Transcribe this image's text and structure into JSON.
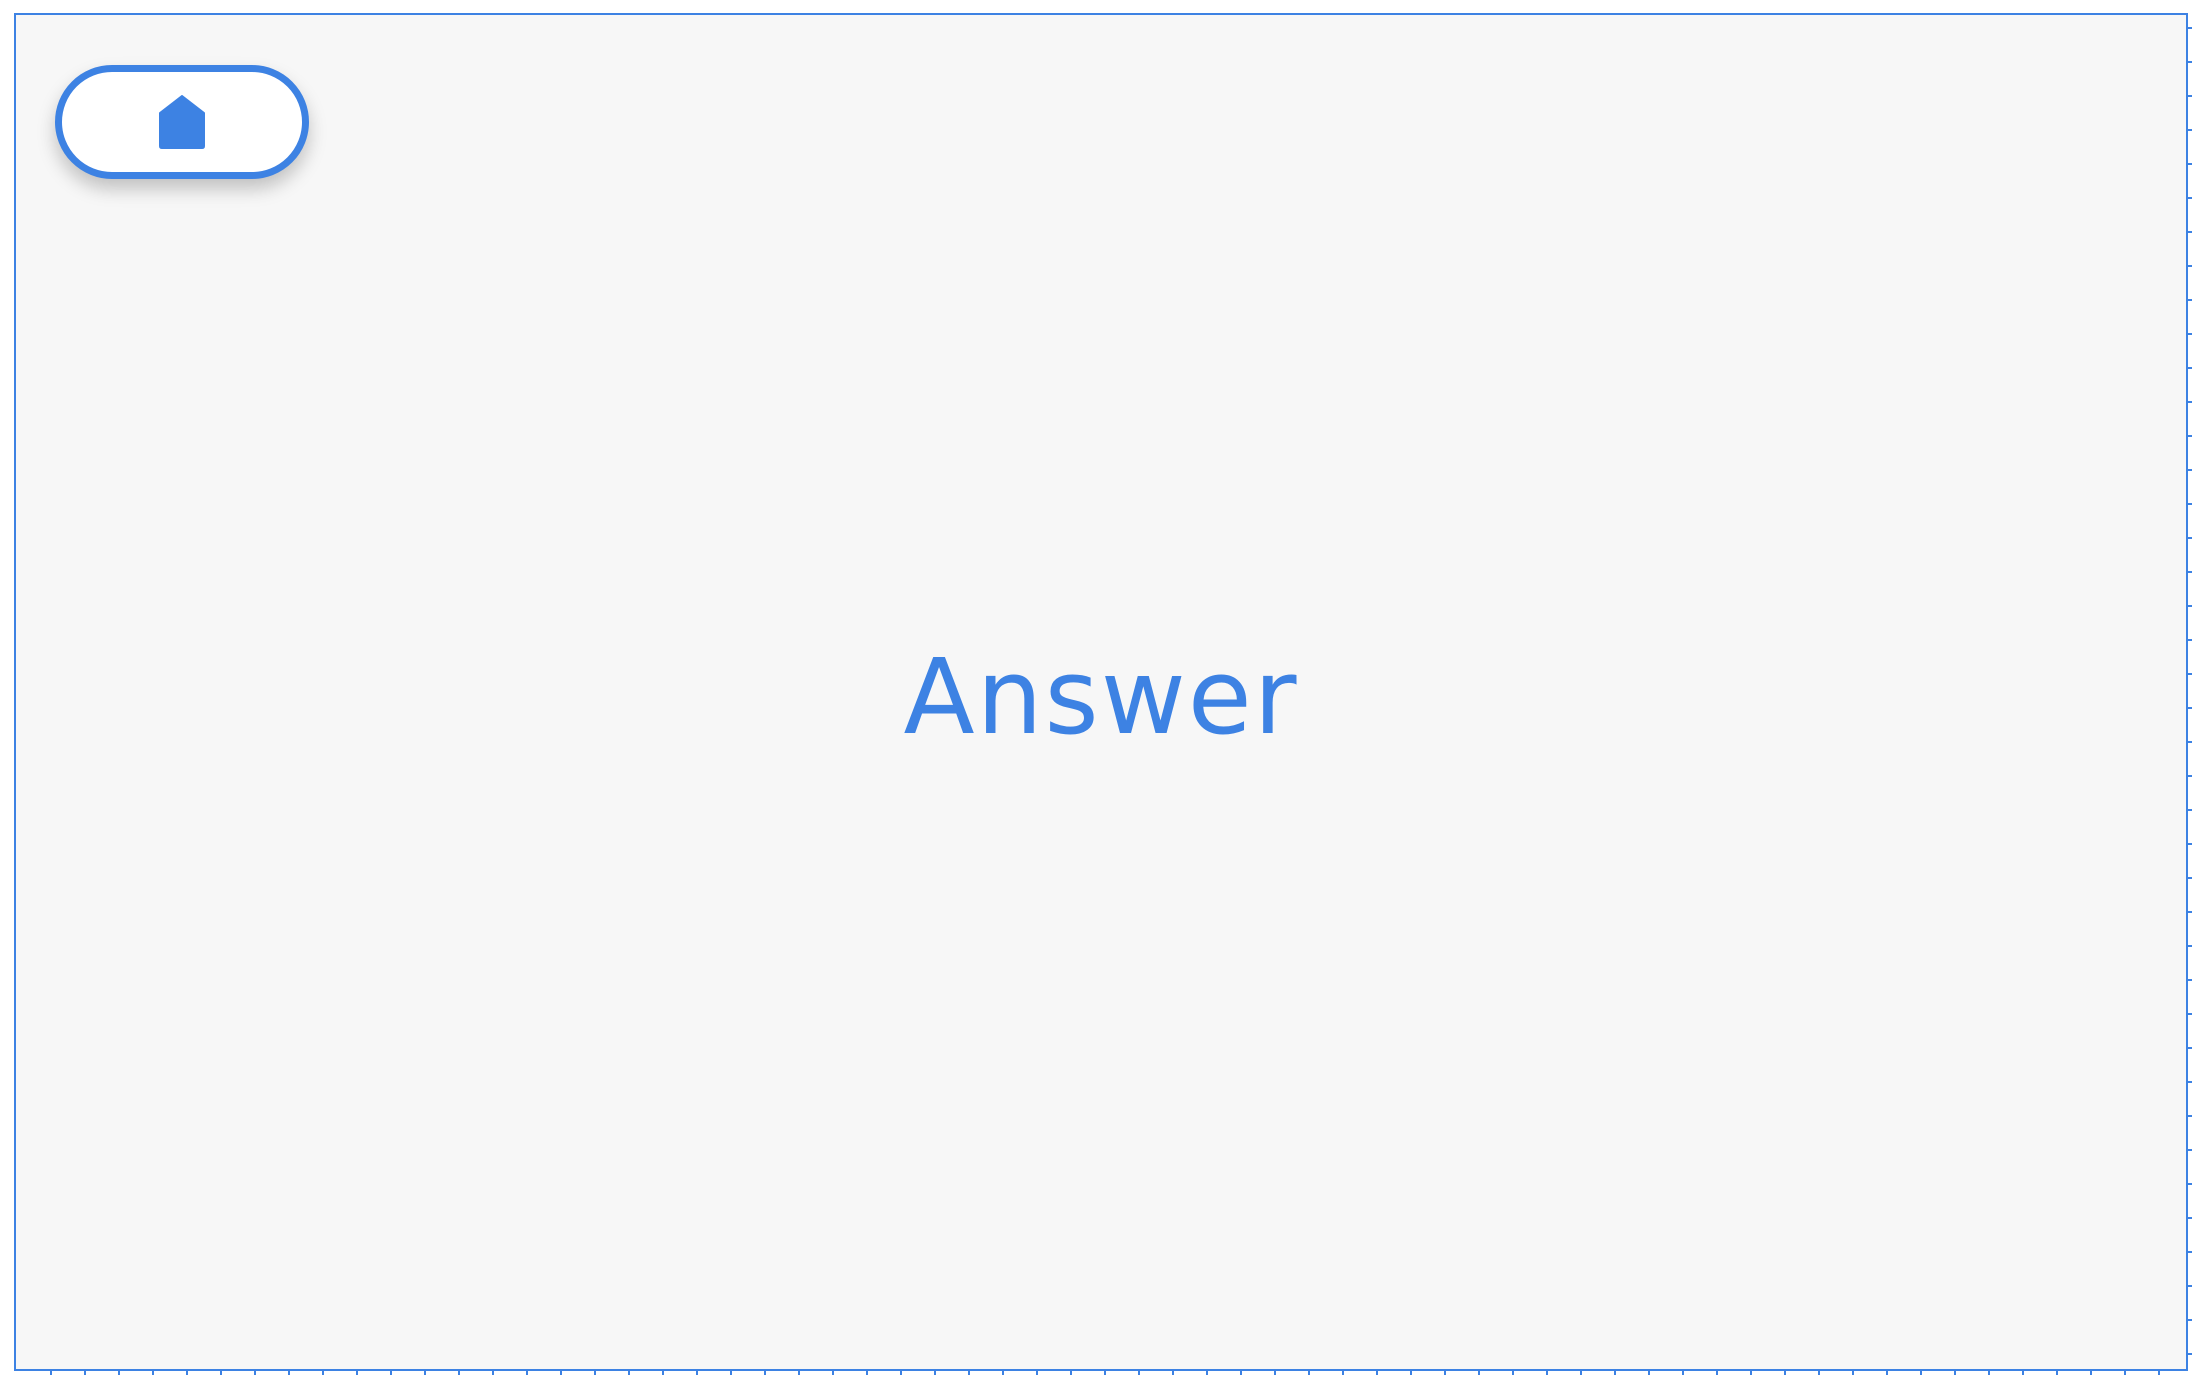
{
  "home_button": {
    "icon": "home-icon",
    "label": ""
  },
  "card": {
    "text": "Answer"
  },
  "colors": {
    "accent": "#3d82e3",
    "background": "#f7f7f7",
    "button_fill": "#ffffff"
  }
}
